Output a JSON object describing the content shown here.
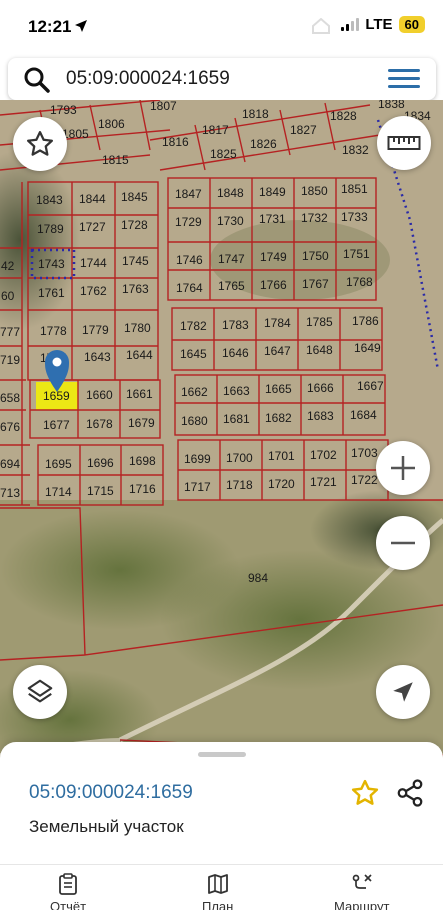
{
  "status_bar": {
    "time": "12:21",
    "network": "LTE",
    "battery": "60"
  },
  "search": {
    "query": "05:09:000024:1659",
    "icon": "search-icon",
    "menu_icon": "menu-icon"
  },
  "map": {
    "highlight_color": "#f6f200",
    "parcel_line_color": "#b52222",
    "boundary_color": "#2a2aa8",
    "selected_parcel": "1659",
    "large_parcel": "984",
    "parcels": [
      "1793",
      "1807",
      "1818",
      "1828",
      "1838",
      "1806",
      "1805",
      "1816",
      "1817",
      "1826",
      "1827",
      "1832",
      "1815",
      "1825",
      "1843",
      "1844",
      "1845",
      "1847",
      "1848",
      "1849",
      "1850",
      "1851",
      "1789",
      "1727",
      "1728",
      "1729",
      "1730",
      "1731",
      "1732",
      "1733",
      "1743",
      "1744",
      "1745",
      "1746",
      "1747",
      "1749",
      "1750",
      "1751",
      "1761",
      "1762",
      "1763",
      "1764",
      "1765",
      "1766",
      "1767",
      "1768",
      "1778",
      "1779",
      "1780",
      "1782",
      "1783",
      "1784",
      "1785",
      "1786",
      "1725",
      "1643",
      "1644",
      "1645",
      "1646",
      "1647",
      "1648",
      "1649",
      "1659",
      "1660",
      "1661",
      "1662",
      "1663",
      "1665",
      "1666",
      "1667",
      "1677",
      "1678",
      "1679",
      "1680",
      "1681",
      "1682",
      "1683",
      "1684",
      "1695",
      "1696",
      "1698",
      "1699",
      "1700",
      "1701",
      "1702",
      "1703",
      "1714",
      "1715",
      "1716",
      "1717",
      "1718",
      "1720",
      "1721",
      "1722",
      "42",
      "60",
      "777",
      "719",
      "658",
      "676",
      "694",
      "713",
      "1834"
    ]
  },
  "controls": {
    "favorite": "star-icon",
    "ruler": "ruler-icon",
    "zoom_in": "+",
    "zoom_out": "−",
    "layers": "layers-icon",
    "locate": "navigation-arrow-icon"
  },
  "sheet": {
    "title": "05:09:000024:1659",
    "subtitle": "Земельный участок"
  },
  "tabs": [
    {
      "label": "Отчёт",
      "icon": "report-icon"
    },
    {
      "label": "План",
      "icon": "map-icon"
    },
    {
      "label": "Маршрут",
      "icon": "route-icon"
    }
  ]
}
